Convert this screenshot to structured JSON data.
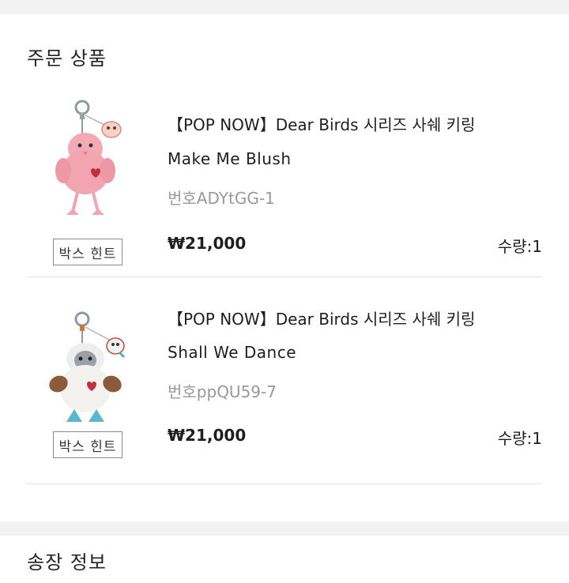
{
  "order_section": {
    "title": "주문 상품"
  },
  "products": [
    {
      "title": "【POP NOW】Dear Birds 시리즈 사쉐 키링",
      "option": "Make Me Blush",
      "code": "번호ADYtGG-1",
      "price": "₩21,000",
      "quantity": "수량:1",
      "hint_label": "박스 힌트",
      "image_icon": "pink-bird-keychain-icon"
    },
    {
      "title": "【POP NOW】Dear Birds 시리즈 사쉐 키링",
      "option": "Shall We Dance",
      "code": "번호ppQU59-7",
      "price": "₩21,000",
      "quantity": "수량:1",
      "hint_label": "박스 힌트",
      "image_icon": "white-owl-keychain-icon"
    }
  ],
  "invoice_section": {
    "title": "송장 정보"
  },
  "colors": {
    "page_bg": "#f2f2f2",
    "card_bg": "#ffffff",
    "divider": "#e2e2e2",
    "muted_text": "#999999"
  }
}
